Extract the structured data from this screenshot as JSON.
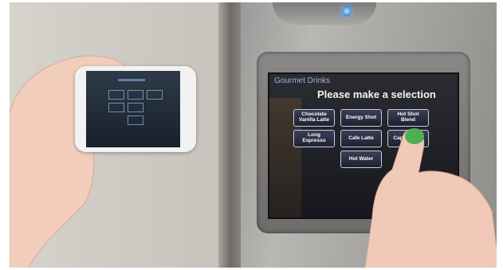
{
  "scene": {
    "description_tags": [
      "wall",
      "coffee-machine",
      "touchscreen",
      "phone",
      "hands"
    ]
  },
  "touchscreen": {
    "header": "Gourmet Drinks",
    "prompt": "Please make a selection",
    "buttons": [
      {
        "label": "Chocolate Vanilla Latte"
      },
      {
        "label": "Energy Shot"
      },
      {
        "label": "Hot Shot Blend"
      },
      {
        "label": "Long Espresso"
      },
      {
        "label": "Cafe Latte"
      },
      {
        "label": "Cappuccino"
      },
      {
        "label": "Hot Water"
      }
    ]
  },
  "colors": {
    "led": "#4a9de0",
    "screen_bg": "#202127",
    "button_border": "#c9ccd8",
    "green_marker": "#4caf50"
  },
  "icons": {
    "status_led": "blue-led-icon",
    "marker": "green-dot-icon"
  }
}
